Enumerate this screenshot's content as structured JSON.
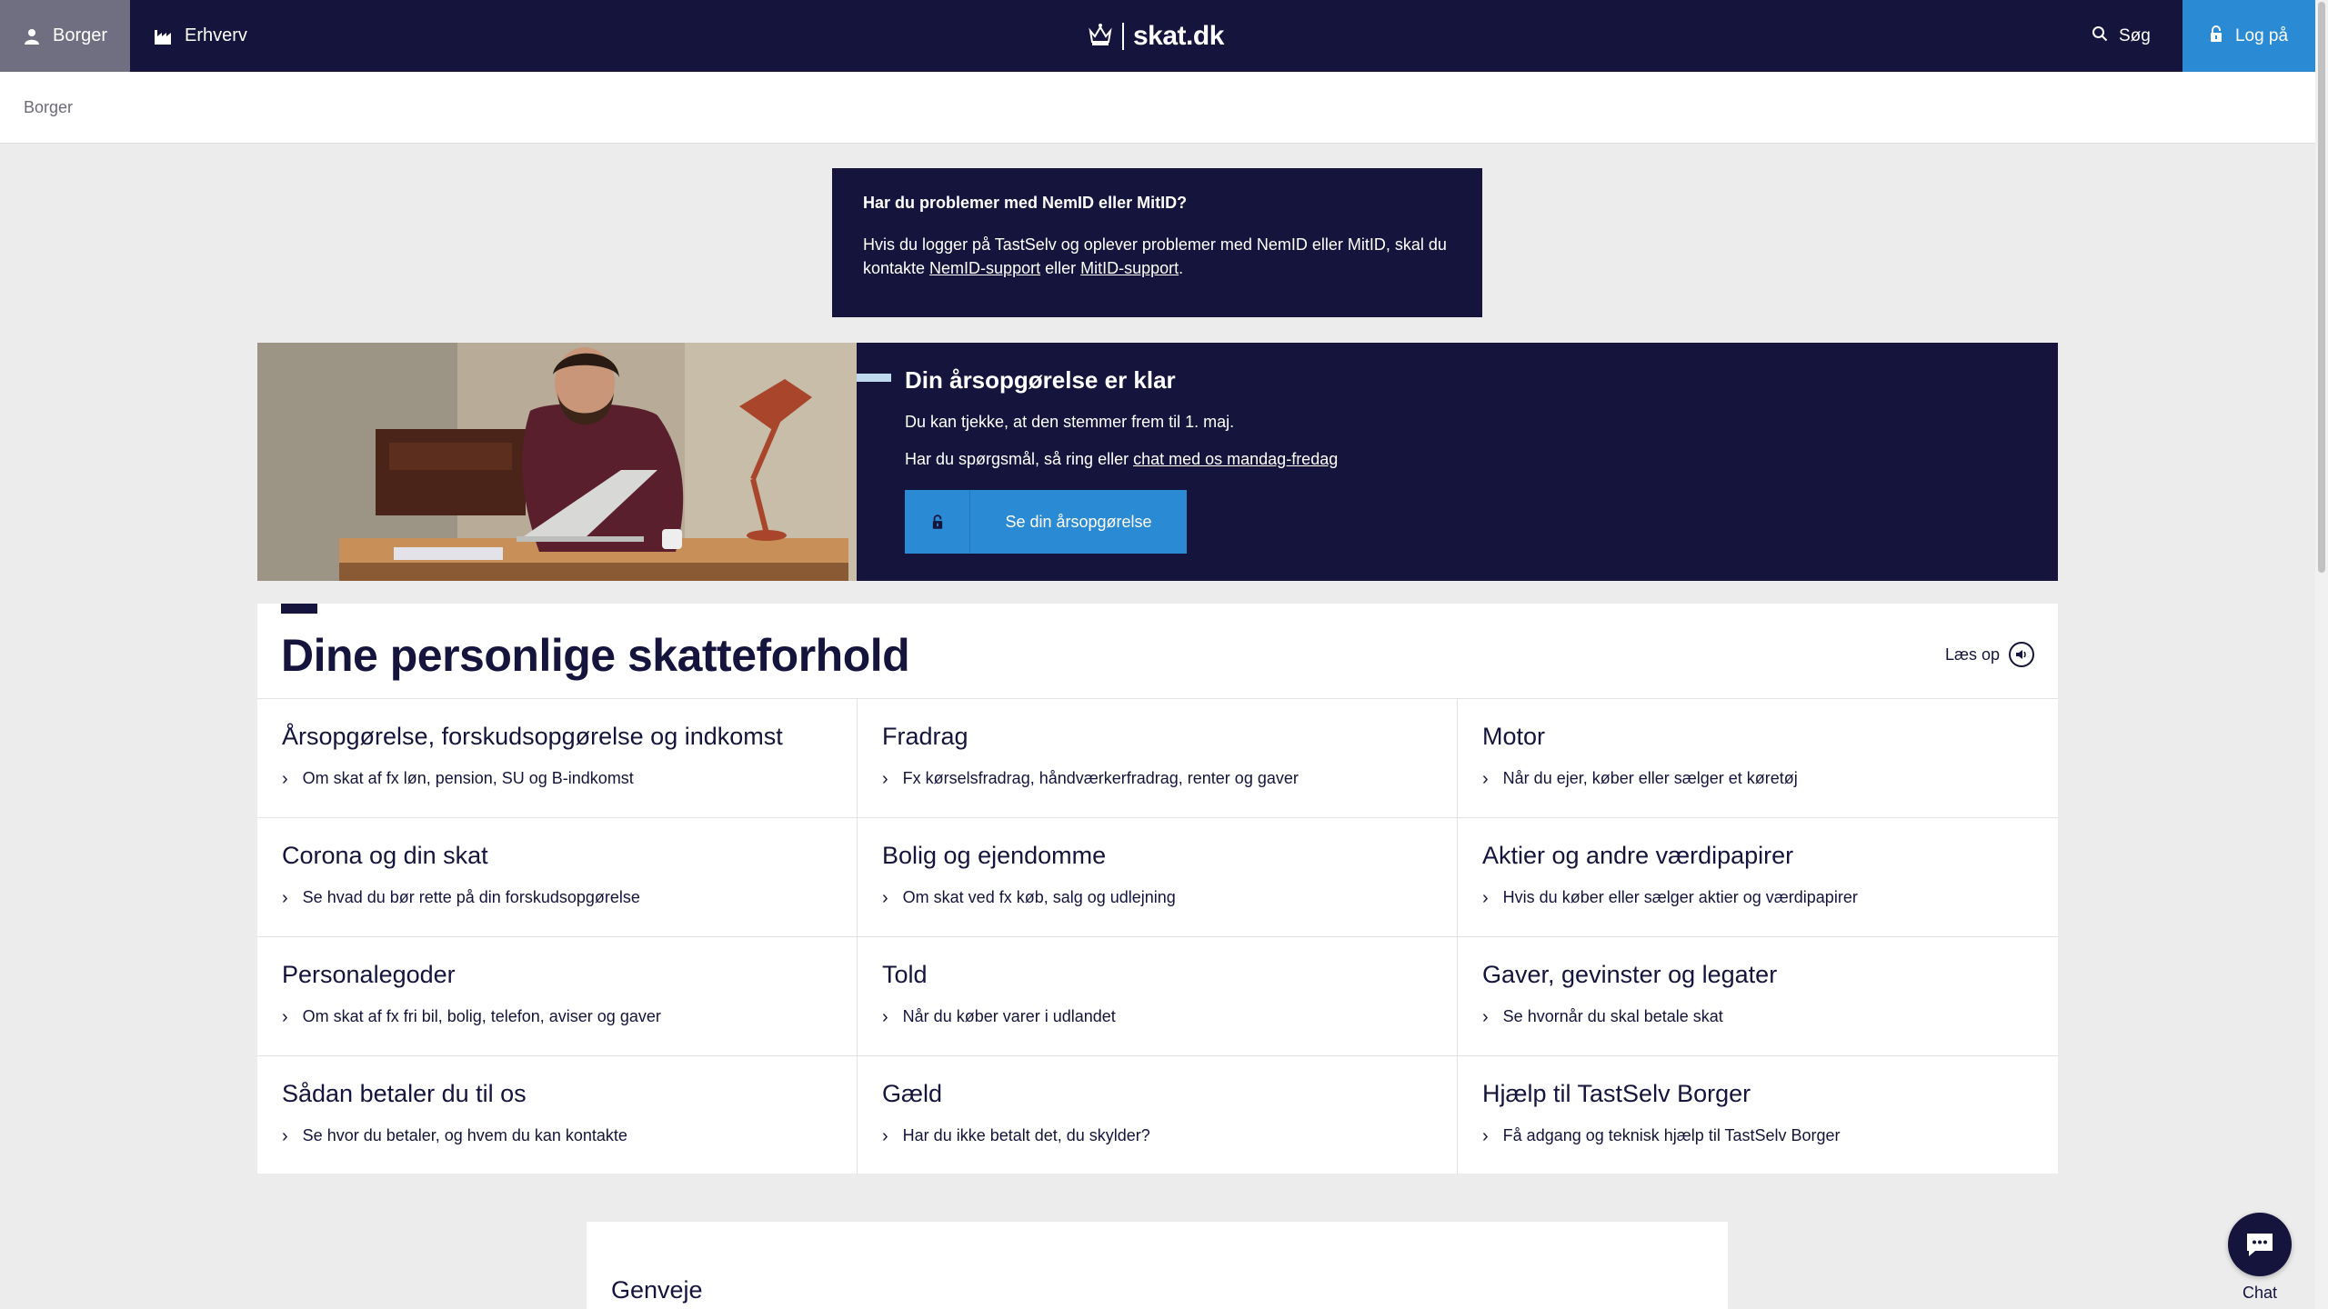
{
  "nav": {
    "tabs": [
      {
        "label": "Borger",
        "icon": "person-icon",
        "active": true
      },
      {
        "label": "Erhverv",
        "icon": "factory-icon",
        "active": false
      }
    ],
    "logo_text": "skat.dk",
    "search_label": "Søg",
    "login_label": "Log på"
  },
  "breadcrumb": {
    "items": [
      "Borger"
    ]
  },
  "notice": {
    "title": "Har du problemer med NemID eller MitID?",
    "text_before": "Hvis du logger på TastSelv og oplever problemer med NemID eller MitID, skal du kontakte ",
    "link1": "NemID-support",
    "text_middle": " eller ",
    "link2": "MitID-support",
    "text_after": "."
  },
  "hero": {
    "title": "Din årsopgørelse er klar",
    "line1": "Du kan tjekke, at den stemmer frem til 1. maj.",
    "line2_before": "Har du spørgsmål, så ring eller ",
    "line2_link": "chat med os mandag-fredag",
    "button_label": "Se din årsopgørelse"
  },
  "section": {
    "title": "Dine personlige skatteforhold",
    "read_aloud_label": "Læs op",
    "items": [
      {
        "title": "Årsopgørelse, forskudsopgørelse og indkomst",
        "subtitle": "Om skat af fx løn, pension, SU og B-indkomst"
      },
      {
        "title": "Fradrag",
        "subtitle": "Fx kørselsfradrag, håndværkerfradrag, renter og gaver"
      },
      {
        "title": "Motor",
        "subtitle": "Når du ejer, køber eller sælger et køretøj"
      },
      {
        "title": "Corona og din skat",
        "subtitle": "Se hvad du bør rette på din forskudsopgørelse"
      },
      {
        "title": "Bolig og ejendomme",
        "subtitle": "Om skat ved fx køb, salg og udlejning"
      },
      {
        "title": "Aktier og andre værdipapirer",
        "subtitle": "Hvis du køber eller sælger aktier og værdipapirer"
      },
      {
        "title": "Personalegoder",
        "subtitle": "Om skat af fx fri bil, bolig, telefon, aviser og gaver"
      },
      {
        "title": "Told",
        "subtitle": "Når du køber varer i udlandet"
      },
      {
        "title": "Gaver, gevinster og legater",
        "subtitle": "Se hvornår du skal betale skat"
      },
      {
        "title": "Sådan betaler du til os",
        "subtitle": "Se hvor du betaler, og hvem du kan kontakte"
      },
      {
        "title": "Gæld",
        "subtitle": "Har du ikke betalt det, du skylder?"
      },
      {
        "title": "Hjælp til TastSelv Borger",
        "subtitle": "Få adgang og teknisk hjælp til TastSelv Borger"
      }
    ]
  },
  "shortcut": {
    "title": "Genveje"
  },
  "chat": {
    "label": "Chat"
  },
  "colors": {
    "navy": "#14143c",
    "blue": "#2a8ad3",
    "active_tab": "#6f6f81",
    "page_bg": "#ececec"
  }
}
